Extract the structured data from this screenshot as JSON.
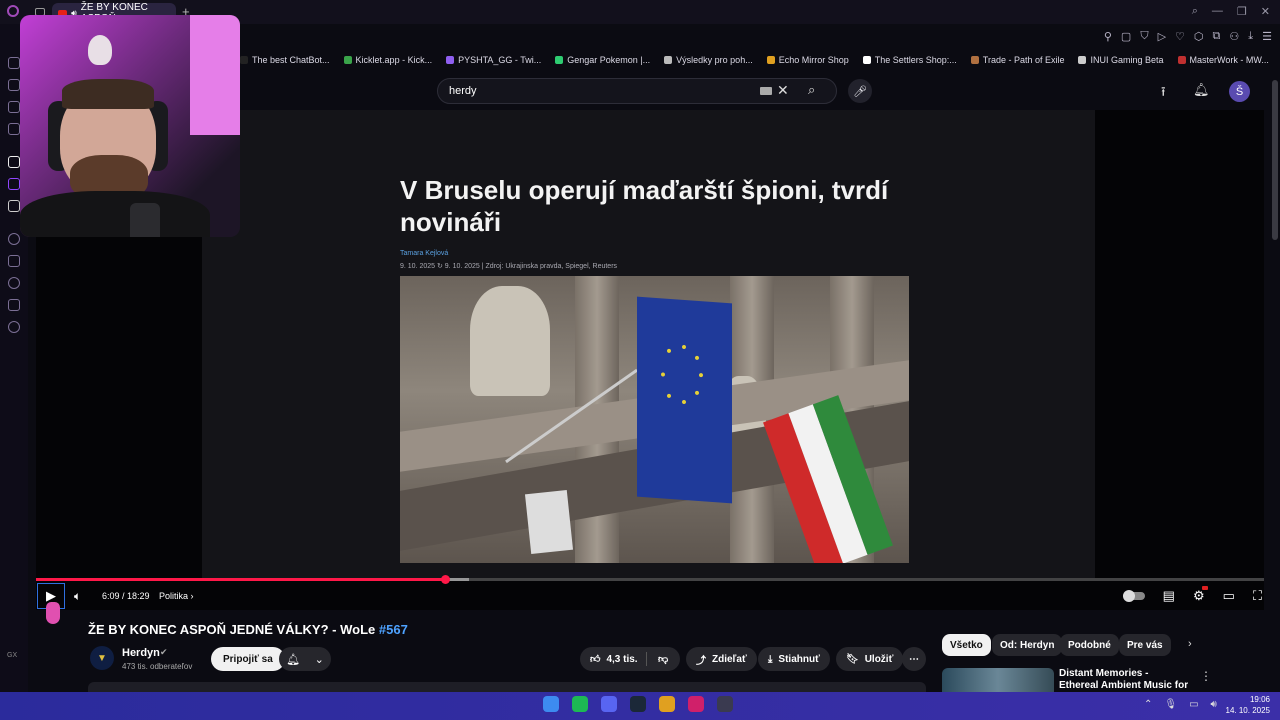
{
  "browser": {
    "tab_title": "ŽE BY KONEC ASPOŇ",
    "new_tab_icon": "+",
    "bookmarks": [
      {
        "label": "The best ChatBot...",
        "color": "#222222"
      },
      {
        "label": "Kicklet.app - Kick...",
        "color": "#3aa44a"
      },
      {
        "label": "PYSHTA_GG - Twi...",
        "color": "#8f5ff0"
      },
      {
        "label": "Gengar Pokemon |...",
        "color": "#2ecc71"
      },
      {
        "label": "Výsledky pro poh...",
        "color": "#bbbbbb"
      },
      {
        "label": "Echo Mirror Shop",
        "color": "#e0a020"
      },
      {
        "label": "The Settlers Shop:...",
        "color": "#ffffff"
      },
      {
        "label": "Trade - Path of Exile",
        "color": "#b07040"
      },
      {
        "label": "INUI Gaming Beta",
        "color": "#cccccc"
      },
      {
        "label": "MasterWork - MW...",
        "color": "#c03030"
      }
    ]
  },
  "youtube": {
    "search_query": "herdy",
    "avatar_letter": "Š"
  },
  "article": {
    "headline": "V Bruselu operují maďarští špioni, tvrdí novináři",
    "author": "Tamara Kejlová",
    "meta": "9. 10. 2025 ↻ 9. 10. 2025  |  Zdroj: Ukrajinska pravda, Spiegel, Reuters"
  },
  "player": {
    "time": "6:09 / 18:29",
    "chapter": "Politika",
    "progress_fraction": 0.333,
    "buffer_fraction": 0.353
  },
  "video": {
    "title": "ŽE BY KONEC ASPOŇ JEDNÉ VÁLKY? - WoLe",
    "hashtag": "#567",
    "channel": "Herdyn",
    "subscribers": "473 tis. odberateľov",
    "join_label": "Pripojiť sa",
    "likes": "4,3 tis.",
    "share_label": "Zdieľať",
    "download_label": "Stiahnuť",
    "save_label": "Uložiť"
  },
  "chips": [
    "Všetko",
    "Od: Herdyn",
    "Podobné",
    "Pre vás"
  ],
  "recommendation": {
    "title": "Distant Memories - Ethereal Ambient Music for Deep Focu"
  },
  "sidebar": {
    "gx_label": "GX"
  },
  "taskbar": {
    "time": "19:06",
    "date": "14. 10. 2025",
    "apps": [
      {
        "name": "windows-start",
        "color": "#3d8bf0"
      },
      {
        "name": "spotify",
        "color": "#1db954"
      },
      {
        "name": "discord",
        "color": "#5865f2"
      },
      {
        "name": "steam",
        "color": "#1b2838"
      },
      {
        "name": "chrome",
        "color": "#e0a020"
      },
      {
        "name": "opera-gx",
        "color": "#d0206a"
      },
      {
        "name": "obs",
        "color": "#3a3a50"
      }
    ]
  },
  "colors": {
    "progress": "#ff1848",
    "accent_link": "#4ea2ff"
  }
}
